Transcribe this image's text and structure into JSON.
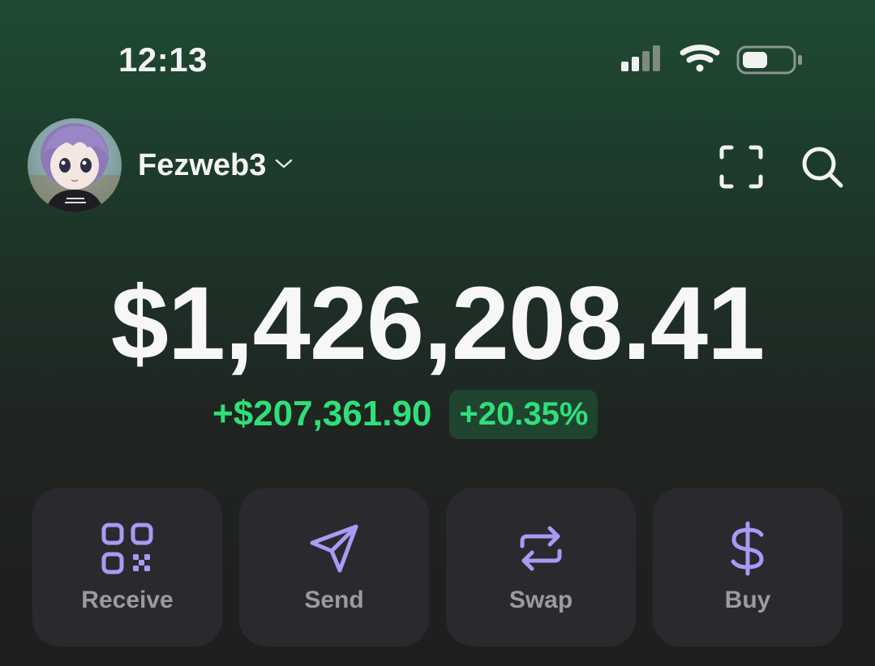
{
  "status_bar": {
    "time": "12:13",
    "icons": [
      "cellular-signal-icon",
      "wifi-icon",
      "battery-icon"
    ]
  },
  "header": {
    "account_name": "Fezweb3",
    "avatar": "avatar",
    "icons": [
      "chevron-down-icon",
      "scan-icon",
      "search-icon"
    ]
  },
  "portfolio": {
    "balance": "$1,426,208.41",
    "change_amount": "+$207,361.90",
    "change_percent": "+20.35%"
  },
  "actions": [
    {
      "label": "Receive",
      "icon": "qr-code-icon"
    },
    {
      "label": "Send",
      "icon": "send-icon"
    },
    {
      "label": "Swap",
      "icon": "swap-icon"
    },
    {
      "label": "Buy",
      "icon": "dollar-icon"
    }
  ],
  "colors": {
    "accent": "#a99af5",
    "positive": "#2ee07a",
    "card": "#2a2a2e",
    "background_top": "#1f4a33",
    "background_bottom": "#1e1e1f"
  }
}
